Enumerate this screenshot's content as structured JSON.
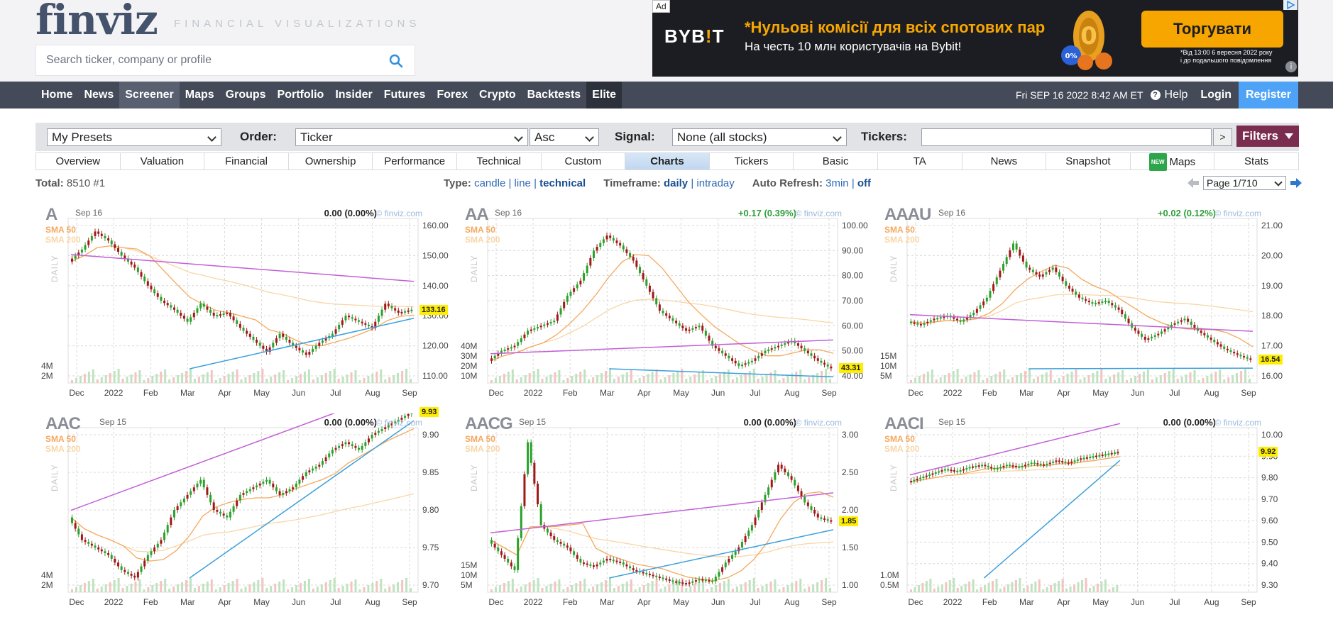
{
  "header": {
    "logo_text": "finviz",
    "tagline": "FINANCIAL VISUALIZATIONS",
    "search_placeholder": "Search ticker, company or profile"
  },
  "ad": {
    "tag": "Ad",
    "brand_prefix": "BYB",
    "brand_accent": "!",
    "brand_suffix": "T",
    "headline": "*Нульові комісії для всіх спотових пар",
    "subline": "На честь 10 млн користувачів на Bybit!",
    "cta": "Торгувати",
    "fine_print_1": "*Від 13:00 6 вересня 2022 року",
    "fine_print_2": "і до подальшого повідомлення",
    "info": "i"
  },
  "nav": {
    "items": [
      "Home",
      "News",
      "Screener",
      "Maps",
      "Groups",
      "Portfolio",
      "Insider",
      "Futures",
      "Forex",
      "Crypto",
      "Backtests",
      "Elite"
    ],
    "active": "Screener",
    "datetime": "Fri SEP 16 2022 8:42 AM ET",
    "help": "Help",
    "help_icon": "?",
    "login": "Login",
    "register": "Register"
  },
  "filterbar": {
    "presets_value": "My Presets",
    "order_label": "Order:",
    "order_value": "Ticker",
    "direction_value": "Asc",
    "signal_label": "Signal:",
    "signal_value": "None (all stocks)",
    "tickers_label": "Tickers:",
    "tickers_value": "",
    "go_label": ">",
    "filters_label": "Filters"
  },
  "tabs": {
    "items": [
      "Overview",
      "Valuation",
      "Financial",
      "Ownership",
      "Performance",
      "Technical",
      "Custom",
      "Charts",
      "Tickers",
      "Basic",
      "TA",
      "News",
      "Snapshot",
      "Maps",
      "Stats"
    ],
    "active": "Charts",
    "maps_badge": "NEW"
  },
  "options": {
    "total_label": "Total:",
    "total_value": "8510 #1",
    "type_label": "Type:",
    "type_candle": "candle",
    "type_line": "line",
    "type_technical": "technical",
    "timeframe_label": "Timeframe:",
    "timeframe_daily": "daily",
    "timeframe_intraday": "intraday",
    "refresh_label": "Auto Refresh:",
    "refresh_3min": "3min",
    "refresh_off": "off",
    "separator": "|",
    "page_value": "Page 1/710"
  },
  "charts": [
    {
      "ticker": "A",
      "date": "Sep 16",
      "change": "0.00 (0.00%)",
      "dir": "zero",
      "last": "133.16",
      "sma50": "SMA 50",
      "sma200": "SMA 200",
      "brand": "© finviz.com",
      "daily": "DAILY",
      "yticks": [
        "160.00",
        "150.00",
        "140.00",
        "130.00",
        "120.00",
        "110.00"
      ],
      "vticks": [
        "4M",
        "2M"
      ],
      "xticks": [
        "Dec",
        "2022",
        "Feb",
        "Mar",
        "Apr",
        "May",
        "Jun",
        "Jul",
        "Aug",
        "Sep"
      ],
      "path": [
        148,
        152,
        158,
        155,
        150,
        146,
        140,
        135,
        132,
        128,
        134,
        130,
        131,
        126,
        122,
        118,
        124,
        120,
        117,
        121,
        124,
        130,
        128,
        126,
        134,
        131,
        132
      ]
    },
    {
      "ticker": "AA",
      "date": "Sep 16",
      "change": "+0.17 (0.39%)",
      "dir": "up",
      "last": "43.31",
      "sma50": "SMA 50",
      "sma200": "SMA 200",
      "brand": "© finviz.com",
      "daily": "DAILY",
      "yticks": [
        "100.00",
        "90.00",
        "80.00",
        "70.00",
        "60.00",
        "50.00",
        "40.00"
      ],
      "vticks": [
        "40M",
        "30M",
        "20M",
        "10M"
      ],
      "xticks": [
        "Dec",
        "2022",
        "Feb",
        "Mar",
        "Apr",
        "May",
        "Jun",
        "Jul",
        "Aug",
        "Sep"
      ],
      "path": [
        46,
        50,
        52,
        58,
        60,
        62,
        72,
        78,
        90,
        96,
        92,
        86,
        76,
        66,
        62,
        58,
        60,
        52,
        48,
        44,
        46,
        50,
        52,
        54,
        50,
        46,
        43
      ]
    },
    {
      "ticker": "AAAU",
      "date": "Sep 16",
      "change": "+0.02 (0.12%)",
      "dir": "up",
      "last": "16.54",
      "sma50": "SMA 50",
      "sma200": "SMA 200",
      "brand": "© finviz.com",
      "daily": "DAILY",
      "yticks": [
        "21.00",
        "20.00",
        "19.00",
        "18.00",
        "17.00",
        "16.00"
      ],
      "vticks": [
        "15M",
        "10M",
        "5M"
      ],
      "xticks": [
        "Dec",
        "2022",
        "Feb",
        "Mar",
        "Apr",
        "May",
        "Jun",
        "Jul",
        "Aug",
        "Sep"
      ],
      "path": [
        17.8,
        17.7,
        17.9,
        18.0,
        17.8,
        18.1,
        18.6,
        19.5,
        20.4,
        19.6,
        19.3,
        19.6,
        19.0,
        18.6,
        18.4,
        18.5,
        18.2,
        17.6,
        17.2,
        17.4,
        17.7,
        17.9,
        17.5,
        17.2,
        16.9,
        16.7,
        16.54
      ]
    },
    {
      "ticker": "AAC",
      "date": "Sep 15",
      "change": "0.00 (0.00%)",
      "dir": "zero",
      "last": "9.93",
      "sma50": "SMA 50",
      "sma200": "SMA 200",
      "brand": "© finviz.com",
      "daily": "DAILY",
      "yticks": [
        "9.90",
        "9.85",
        "9.80",
        "9.75",
        "9.70"
      ],
      "vticks": [
        "4M",
        "2M"
      ],
      "xticks": [
        "Dec",
        "2022",
        "Feb",
        "Mar",
        "Apr",
        "May",
        "Jun",
        "Jul",
        "Aug",
        "Sep"
      ],
      "path": [
        9.79,
        9.76,
        9.75,
        9.74,
        9.72,
        9.71,
        9.74,
        9.76,
        9.8,
        9.82,
        9.84,
        9.8,
        9.79,
        9.82,
        9.83,
        9.84,
        9.82,
        9.83,
        9.85,
        9.86,
        9.88,
        9.89,
        9.88,
        9.9,
        9.91,
        9.92,
        9.93
      ]
    },
    {
      "ticker": "AACG",
      "date": "Sep 15",
      "change": "0.00 (0.00%)",
      "dir": "zero",
      "last": "1.85",
      "sma50": "SMA 50",
      "sma200": "SMA 200",
      "brand": "© finviz.com",
      "daily": "DAILY",
      "yticks": [
        "3.00",
        "2.50",
        "2.00",
        "1.50",
        "1.00"
      ],
      "vticks": [
        "15M",
        "10M",
        "5M"
      ],
      "xticks": [
        "Dec",
        "2022",
        "Feb",
        "Mar",
        "Apr",
        "May",
        "Jun",
        "Jul",
        "Aug",
        "Sep"
      ],
      "path": [
        1.6,
        1.4,
        1.2,
        2.9,
        1.8,
        1.6,
        1.5,
        1.3,
        1.25,
        1.35,
        1.3,
        1.2,
        1.15,
        1.1,
        1.05,
        1.02,
        1.08,
        1.05,
        1.3,
        1.5,
        1.8,
        2.2,
        2.6,
        2.4,
        2.1,
        1.9,
        1.85
      ]
    },
    {
      "ticker": "AACI",
      "date": "Sep 15",
      "change": "0.00 (0.00%)",
      "dir": "zero",
      "last": "9.92",
      "sma50": "SMA 50",
      "sma200": "SMA 200",
      "brand": "© finviz.com",
      "daily": "DAILY",
      "yticks": [
        "10.00",
        "9.90",
        "9.80",
        "9.70",
        "9.60",
        "9.50",
        "9.40",
        "9.30"
      ],
      "vticks": [
        "1.0M",
        "0.5M"
      ],
      "xticks": [
        "Dec",
        "2022",
        "Feb",
        "Mar",
        "Apr",
        "May",
        "Jun",
        "Jul",
        "Aug",
        "Sep"
      ],
      "path": [
        9.78,
        9.8,
        9.82,
        9.84,
        9.83,
        9.85,
        9.86,
        9.84,
        9.86,
        9.85,
        9.87,
        9.86,
        9.88,
        9.87,
        9.89,
        9.9,
        9.91,
        9.92
      ]
    }
  ]
}
